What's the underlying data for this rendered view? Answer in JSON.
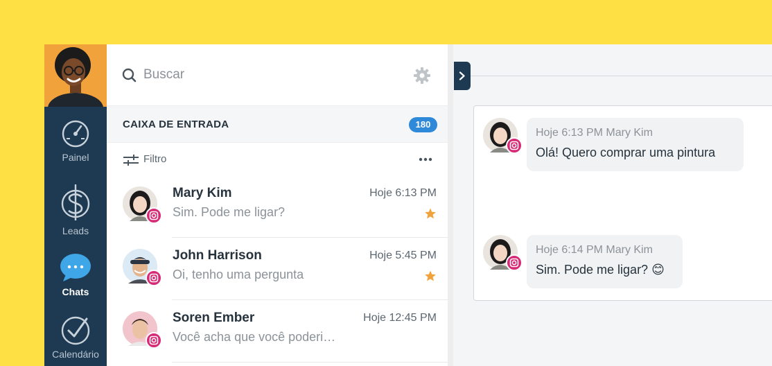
{
  "nav": {
    "items": [
      {
        "label": "Painel",
        "icon": "dashboard-gauge-icon"
      },
      {
        "label": "Leads",
        "icon": "dollar-icon"
      },
      {
        "label": "Chats",
        "icon": "chat-bubble-icon",
        "active": true
      },
      {
        "label": "Calendário",
        "icon": "calendar-check-icon"
      }
    ]
  },
  "search": {
    "placeholder": "Buscar"
  },
  "inbox": {
    "title": "CAIXA DE ENTRADA",
    "count": "180"
  },
  "filter": {
    "label": "Filtro"
  },
  "conversations": [
    {
      "name": "Mary Kim",
      "time": "Hoje 6:13 PM",
      "preview": "Sim. Pode me ligar?",
      "starred": true,
      "channel": "instagram"
    },
    {
      "name": "John Harrison",
      "time": "Hoje 5:45 PM",
      "preview": "Oi, tenho uma pergunta",
      "starred": true,
      "channel": "instagram"
    },
    {
      "name": "Soren Ember",
      "time": "Hoje 12:45 PM",
      "preview": "Você acha que você poderi…",
      "starred": false,
      "channel": "instagram"
    }
  ],
  "chat": {
    "messages": [
      {
        "meta": "Hoje 6:13 PM Mary Kim",
        "text": "Olá! Quero comprar uma pintura"
      },
      {
        "meta": "Hoje 6:14 PM Mary Kim",
        "text": "Sim. Pode me ligar?",
        "emoji": "😊"
      }
    ]
  },
  "colors": {
    "background": "#FFE044",
    "nav": "#1E3A52",
    "accent": "#2F89D9",
    "star": "#F2A23A",
    "instagram": "#D62976"
  }
}
